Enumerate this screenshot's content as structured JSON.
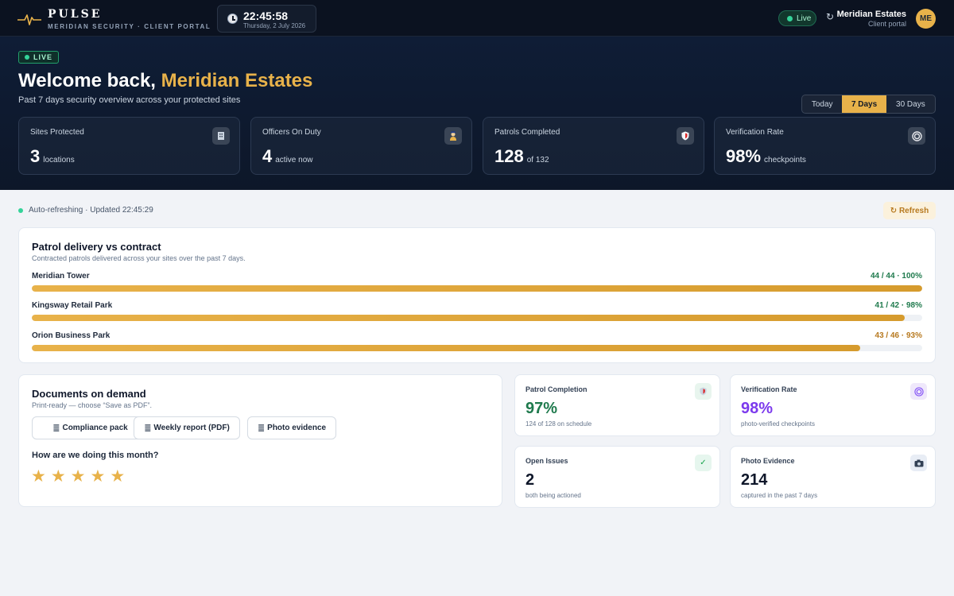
{
  "header": {
    "brand_name": "PULSE",
    "brand_sub": "MERIDIAN SECURITY · CLIENT PORTAL",
    "time": "22:45:58",
    "date": "Thursday, 2 July 2026",
    "live_label": "Live",
    "client_name": "Meridian Estates",
    "client_role": "Client portal",
    "avatar_initials": "ME"
  },
  "hero": {
    "badge": "LIVE",
    "welcome_prefix": "Welcome back, ",
    "welcome_name": "Meridian Estates",
    "subtitle": "Past 7 days security overview across your protected sites",
    "periods": [
      "Today",
      "7 Days",
      "30 Days"
    ],
    "active_period": "7 Days",
    "kpis": [
      {
        "label": "Sites Protected",
        "value": "3",
        "sub": "locations",
        "icon": "building-icon"
      },
      {
        "label": "Officers On Duty",
        "value": "4",
        "sub": "active now",
        "icon": "officer-icon"
      },
      {
        "label": "Patrols Completed",
        "value": "128",
        "sub": "of 132",
        "icon": "shield-icon"
      },
      {
        "label": "Verification Rate",
        "value": "98%",
        "sub": "checkpoints",
        "icon": "target-icon"
      }
    ]
  },
  "status": {
    "text": "Auto-refreshing · Updated 22:45:29",
    "refresh_label": "↻ Refresh"
  },
  "patrol": {
    "title": "Patrol delivery vs contract",
    "subtitle": "Contracted patrols delivered across your sites over the past 7 days.",
    "sites": [
      {
        "name": "Meridian Tower",
        "stat": "44 / 44 · 100%",
        "fraction": 1.0,
        "color": "#1f7a4d"
      },
      {
        "name": "Kingsway Retail Park",
        "stat": "41 / 42 · 98%",
        "fraction": 0.98,
        "color": "#1f7a4d"
      },
      {
        "name": "Orion Business Park",
        "stat": "43 / 46 · 93%",
        "fraction": 0.93,
        "color": "#b7791f"
      }
    ]
  },
  "documents": {
    "title": "Documents on demand",
    "subtitle": "Print-ready — choose “Save as PDF”.",
    "buttons": [
      "Compliance pack",
      "Weekly report (PDF)",
      "Photo evidence"
    ],
    "question": "How are we doing this month?",
    "rating_stars": 5
  },
  "metrics": [
    {
      "label": "Patrol Completion",
      "value": "97%",
      "sub": "124 of 128 on schedule",
      "color": "#1f7a4d",
      "icon": "shield-icon",
      "icon_bg": "#e8f5ee"
    },
    {
      "label": "Verification Rate",
      "value": "98%",
      "sub": "photo-verified checkpoints",
      "color": "#7c3aed",
      "icon": "target-icon",
      "icon_bg": "#efe8fb"
    },
    {
      "label": "Open Issues",
      "value": "2",
      "sub": "both being actioned",
      "color": "#0f172a",
      "icon": "check-icon",
      "icon_bg": "#e6f6ee"
    },
    {
      "label": "Photo Evidence",
      "value": "214",
      "sub": "captured in the past 7 days",
      "color": "#0f172a",
      "icon": "camera-icon",
      "icon_bg": "#e8edf5"
    }
  ]
}
